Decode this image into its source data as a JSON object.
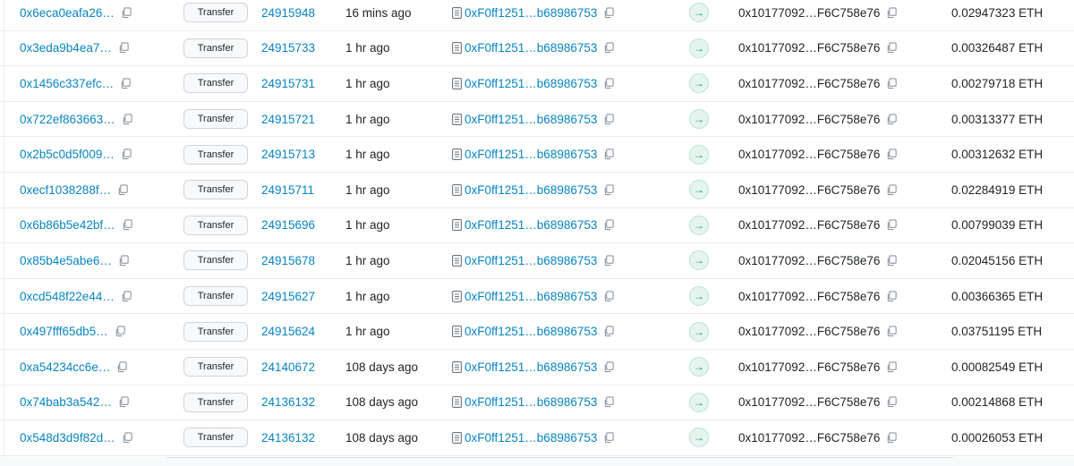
{
  "rows": [
    {
      "hash": "0x6eca0eafa26…",
      "method": "Transfer",
      "block": "24915948",
      "age": "16 mins ago",
      "from": "0xF0ff1251…b68986753",
      "direction": "→",
      "to": "0x10177092…F6C758e76",
      "value": "0.02947323 ETH"
    },
    {
      "hash": "0x3eda9b4ea7…",
      "method": "Transfer",
      "block": "24915733",
      "age": "1 hr ago",
      "from": "0xF0ff1251…b68986753",
      "direction": "→",
      "to": "0x10177092…F6C758e76",
      "value": "0.00326487 ETH"
    },
    {
      "hash": "0x1456c337efc…",
      "method": "Transfer",
      "block": "24915731",
      "age": "1 hr ago",
      "from": "0xF0ff1251…b68986753",
      "direction": "→",
      "to": "0x10177092…F6C758e76",
      "value": "0.00279718 ETH"
    },
    {
      "hash": "0x722ef863663…",
      "method": "Transfer",
      "block": "24915721",
      "age": "1 hr ago",
      "from": "0xF0ff1251…b68986753",
      "direction": "→",
      "to": "0x10177092…F6C758e76",
      "value": "0.00313377 ETH"
    },
    {
      "hash": "0x2b5c0d5f009…",
      "method": "Transfer",
      "block": "24915713",
      "age": "1 hr ago",
      "from": "0xF0ff1251…b68986753",
      "direction": "→",
      "to": "0x10177092…F6C758e76",
      "value": "0.00312632 ETH"
    },
    {
      "hash": "0xecf1038288f…",
      "method": "Transfer",
      "block": "24915711",
      "age": "1 hr ago",
      "from": "0xF0ff1251…b68986753",
      "direction": "→",
      "to": "0x10177092…F6C758e76",
      "value": "0.02284919 ETH"
    },
    {
      "hash": "0x6b86b5e42bf…",
      "method": "Transfer",
      "block": "24915696",
      "age": "1 hr ago",
      "from": "0xF0ff1251…b68986753",
      "direction": "→",
      "to": "0x10177092…F6C758e76",
      "value": "0.00799039 ETH"
    },
    {
      "hash": "0x85b4e5abe6…",
      "method": "Transfer",
      "block": "24915678",
      "age": "1 hr ago",
      "from": "0xF0ff1251…b68986753",
      "direction": "→",
      "to": "0x10177092…F6C758e76",
      "value": "0.02045156 ETH"
    },
    {
      "hash": "0xcd548f22e44…",
      "method": "Transfer",
      "block": "24915627",
      "age": "1 hr ago",
      "from": "0xF0ff1251…b68986753",
      "direction": "→",
      "to": "0x10177092…F6C758e76",
      "value": "0.00366365 ETH"
    },
    {
      "hash": "0x497fff65db5…",
      "method": "Transfer",
      "block": "24915624",
      "age": "1 hr ago",
      "from": "0xF0ff1251…b68986753",
      "direction": "→",
      "to": "0x10177092…F6C758e76",
      "value": "0.03751195 ETH"
    },
    {
      "hash": "0xa54234cc6e…",
      "method": "Transfer",
      "block": "24140672",
      "age": "108 days ago",
      "from": "0xF0ff1251…b68986753",
      "direction": "→",
      "to": "0x10177092…F6C758e76",
      "value": "0.00082549 ETH"
    },
    {
      "hash": "0x74bab3a542…",
      "method": "Transfer",
      "block": "24136132",
      "age": "108 days ago",
      "from": "0xF0ff1251…b68986753",
      "direction": "→",
      "to": "0x10177092…F6C758e76",
      "value": "0.00214868 ETH"
    },
    {
      "hash": "0x548d3d9f82d…",
      "method": "Transfer",
      "block": "24136132",
      "age": "108 days ago",
      "from": "0xF0ff1251…b68986753",
      "direction": "→",
      "to": "0x10177092…F6C758e76",
      "value": "0.00026053 ETH"
    }
  ],
  "colors": {
    "link": "#0784c3",
    "text": "#212529",
    "border": "#e9ecef",
    "direction_badge_bg": "#e6f4ee",
    "direction_badge_fg": "#00a186"
  },
  "icons": {
    "copy": "copy-icon",
    "contract": "document-icon",
    "direction": "arrow-right-icon"
  }
}
